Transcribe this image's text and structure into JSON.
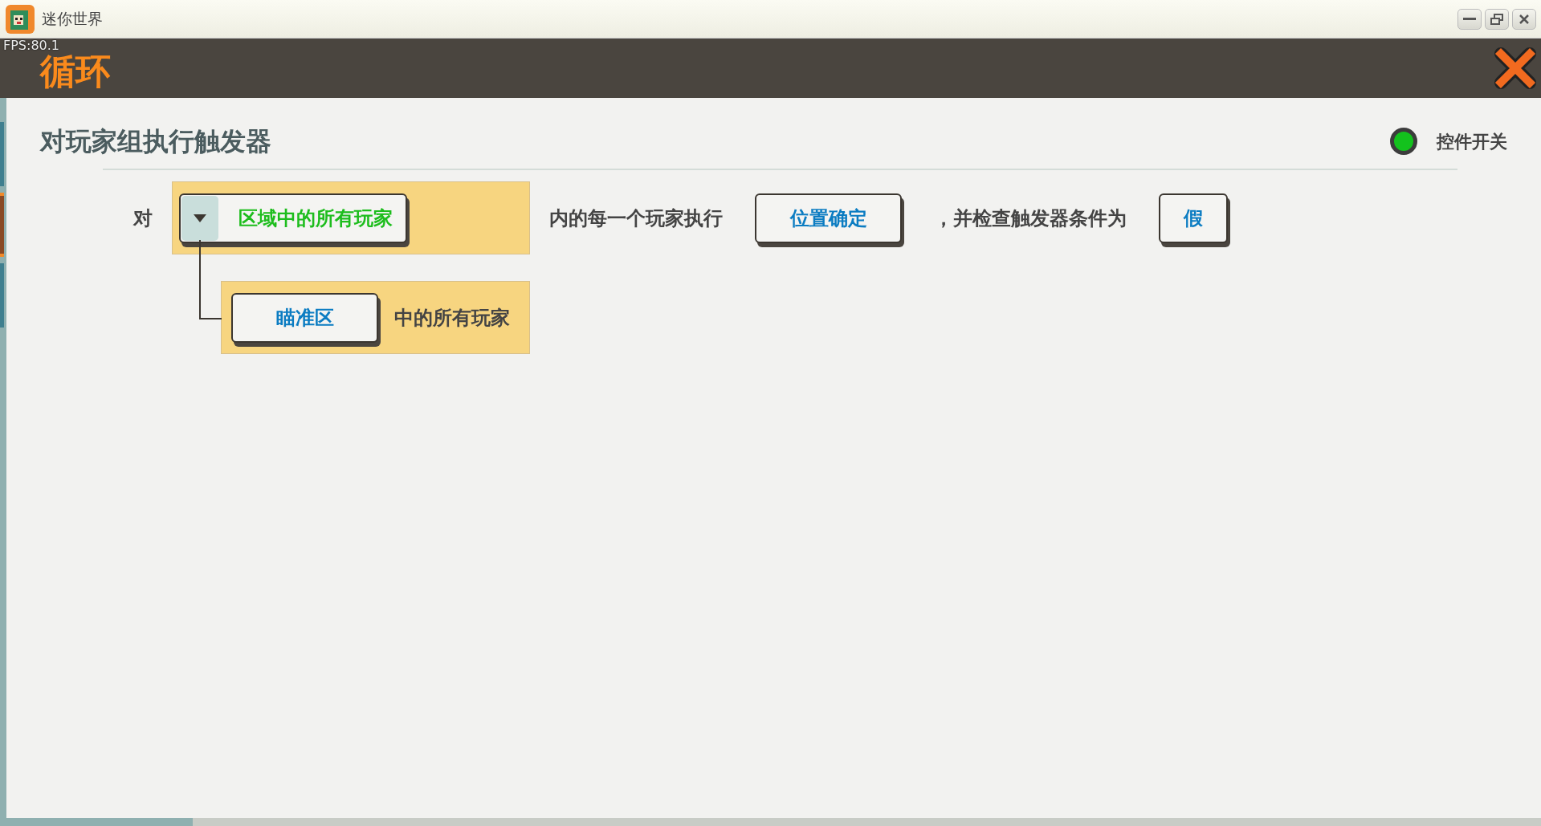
{
  "window": {
    "title": "迷你世界"
  },
  "fps": "FPS:80.1",
  "header": {
    "title": "循环"
  },
  "panel": {
    "title": "对玩家组执行触发器",
    "switch": {
      "label": "控件开关",
      "on": true
    }
  },
  "statement": {
    "parts": [
      {
        "kind": "text",
        "text": "对"
      },
      {
        "kind": "selector",
        "text": "区域中的所有玩家",
        "expanded": true,
        "children": [
          {
            "kind": "button",
            "text": "瞄准区"
          },
          {
            "kind": "text",
            "text": "中的所有玩家"
          }
        ]
      },
      {
        "kind": "text",
        "text": "内的每一个玩家执行"
      },
      {
        "kind": "button",
        "text": "位置确定"
      },
      {
        "kind": "text",
        "text": "，并检查触发器条件为"
      },
      {
        "kind": "button",
        "text": "假"
      }
    ]
  }
}
